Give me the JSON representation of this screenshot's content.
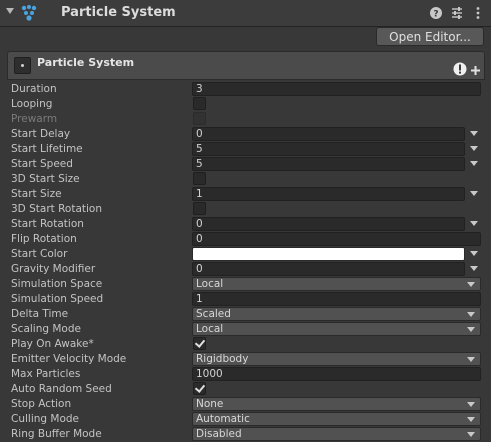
{
  "header": {
    "title": "Particle System",
    "help_icon": "help-icon",
    "settings_icon": "sliders-icon",
    "menu_icon": "kebab-menu-icon"
  },
  "toolbar": {
    "open_editor_label": "Open Editor..."
  },
  "module": {
    "title": "Particle System"
  },
  "fields": {
    "duration": {
      "label": "Duration",
      "value": "3"
    },
    "looping": {
      "label": "Looping",
      "checked": false
    },
    "prewarm": {
      "label": "Prewarm",
      "checked": false
    },
    "start_delay": {
      "label": "Start Delay",
      "value": "0"
    },
    "start_lifetime": {
      "label": "Start Lifetime",
      "value": "5"
    },
    "start_speed": {
      "label": "Start Speed",
      "value": "5"
    },
    "start_size_3d": {
      "label": "3D Start Size",
      "checked": false
    },
    "start_size": {
      "label": "Start Size",
      "value": "1"
    },
    "start_rotation_3d": {
      "label": "3D Start Rotation",
      "checked": false
    },
    "start_rotation": {
      "label": "Start Rotation",
      "value": "0"
    },
    "flip_rotation": {
      "label": "Flip Rotation",
      "value": "0"
    },
    "start_color": {
      "label": "Start Color",
      "color": "#ffffff"
    },
    "gravity_modifier": {
      "label": "Gravity Modifier",
      "value": "0"
    },
    "simulation_space": {
      "label": "Simulation Space",
      "value": "Local"
    },
    "simulation_speed": {
      "label": "Simulation Speed",
      "value": "1"
    },
    "delta_time": {
      "label": "Delta Time",
      "value": "Scaled"
    },
    "scaling_mode": {
      "label": "Scaling Mode",
      "value": "Local"
    },
    "play_on_awake": {
      "label": "Play On Awake*",
      "checked": true
    },
    "emitter_velocity_mode": {
      "label": "Emitter Velocity Mode",
      "value": "Rigidbody"
    },
    "max_particles": {
      "label": "Max Particles",
      "value": "1000"
    },
    "auto_random_seed": {
      "label": "Auto Random Seed",
      "checked": true
    },
    "stop_action": {
      "label": "Stop Action",
      "value": "None"
    },
    "culling_mode": {
      "label": "Culling Mode",
      "value": "Automatic"
    },
    "ring_buffer_mode": {
      "label": "Ring Buffer Mode",
      "value": "Disabled"
    }
  },
  "colors": {
    "panel_bg": "#383838",
    "field_bg": "#2a2a2a",
    "dropdown_bg": "#515151",
    "accent_icon": "#4aa3df"
  }
}
